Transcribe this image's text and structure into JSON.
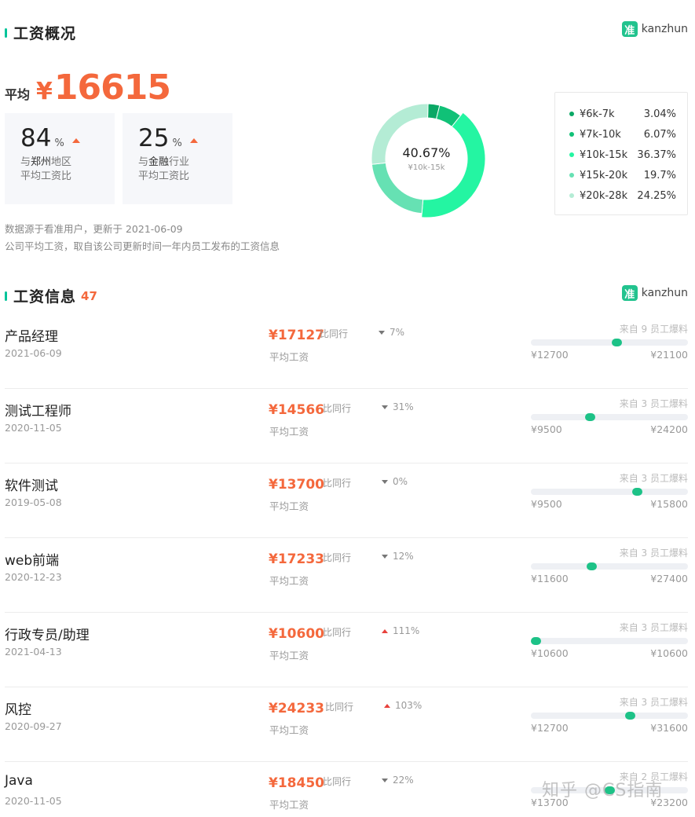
{
  "overview": {
    "title": "工资概况",
    "avg_label": "平均",
    "avg_currency": "¥",
    "avg_value": "16615",
    "region_compare": {
      "value": "84",
      "unit": "%",
      "line1_prefix": "与",
      "line1_highlight": "郑州",
      "line1_suffix": "地区",
      "line2": "平均工资比",
      "trend": "up"
    },
    "industry_compare": {
      "value": "25",
      "unit": "%",
      "line1_prefix": "与",
      "line1_highlight": "金融",
      "line1_suffix": "行业",
      "line2": "平均工资比",
      "trend": "up"
    },
    "note1": "数据源于看准用户，更新于 2021-06-09",
    "note2": "公司平均工资，取自该公司更新时间一年内员工发布的工资信息"
  },
  "brand": {
    "icon_char": "准",
    "name": "kanzhun"
  },
  "donut": {
    "center_pct": "40.67%",
    "center_range": "¥10k-15k",
    "slices": [
      {
        "label": "¥6k-7k",
        "pct": "3.04%",
        "value": 3.04,
        "color": "#0aa865"
      },
      {
        "label": "¥7k-10k",
        "pct": "6.07%",
        "value": 6.07,
        "color": "#10c177"
      },
      {
        "label": "¥10k-15k",
        "pct": "36.37%",
        "value": 36.37,
        "color": "#24f5a2"
      },
      {
        "label": "¥15k-20k",
        "pct": "19.7%",
        "value": 19.7,
        "color": "#66e1b3"
      },
      {
        "label": "¥20k-28k",
        "pct": "24.25%",
        "value": 24.25,
        "color": "#b4ecd5"
      }
    ]
  },
  "salary_info": {
    "title": "工资信息",
    "count": "47",
    "compare_label": "比同行",
    "avg_label": "平均工资",
    "jobs": [
      {
        "name": "产品经理",
        "date": "2021-06-09",
        "salary": "¥17127",
        "trend": "down",
        "trend_pct": "7%",
        "source": "来自 9 员工爆料",
        "min": "¥12700",
        "max": "¥21100",
        "position": 0.55
      },
      {
        "name": "测试工程师",
        "date": "2020-11-05",
        "salary": "¥14566",
        "trend": "down",
        "trend_pct": "31%",
        "source": "来自 3 员工爆料",
        "min": "¥9500",
        "max": "¥24200",
        "position": 0.37
      },
      {
        "name": "软件测试",
        "date": "2019-05-08",
        "salary": "¥13700",
        "trend": "down",
        "trend_pct": "0%",
        "source": "来自 3 员工爆料",
        "min": "¥9500",
        "max": "¥15800",
        "position": 0.69
      },
      {
        "name": "web前端",
        "date": "2020-12-23",
        "salary": "¥17233",
        "trend": "down",
        "trend_pct": "12%",
        "source": "来自 3 员工爆料",
        "min": "¥11600",
        "max": "¥27400",
        "position": 0.38
      },
      {
        "name": "行政专员/助理",
        "date": "2021-04-13",
        "salary": "¥10600",
        "trend": "up",
        "trend_pct": "111%",
        "source": "来自 3 员工爆料",
        "min": "¥10600",
        "max": "¥10600",
        "position": 0.0
      },
      {
        "name": "风控",
        "date": "2020-09-27",
        "salary": "¥24233",
        "trend": "up",
        "trend_pct": "103%",
        "source": "来自 3 员工爆料",
        "min": "¥12700",
        "max": "¥31600",
        "position": 0.64
      },
      {
        "name": "Java",
        "date": "2020-11-05",
        "salary": "¥18450",
        "trend": "down",
        "trend_pct": "22%",
        "source": "来自 2 员工爆料",
        "min": "¥13700",
        "max": "¥23200",
        "position": 0.5
      }
    ]
  },
  "watermark": "知乎 @CS指南"
}
